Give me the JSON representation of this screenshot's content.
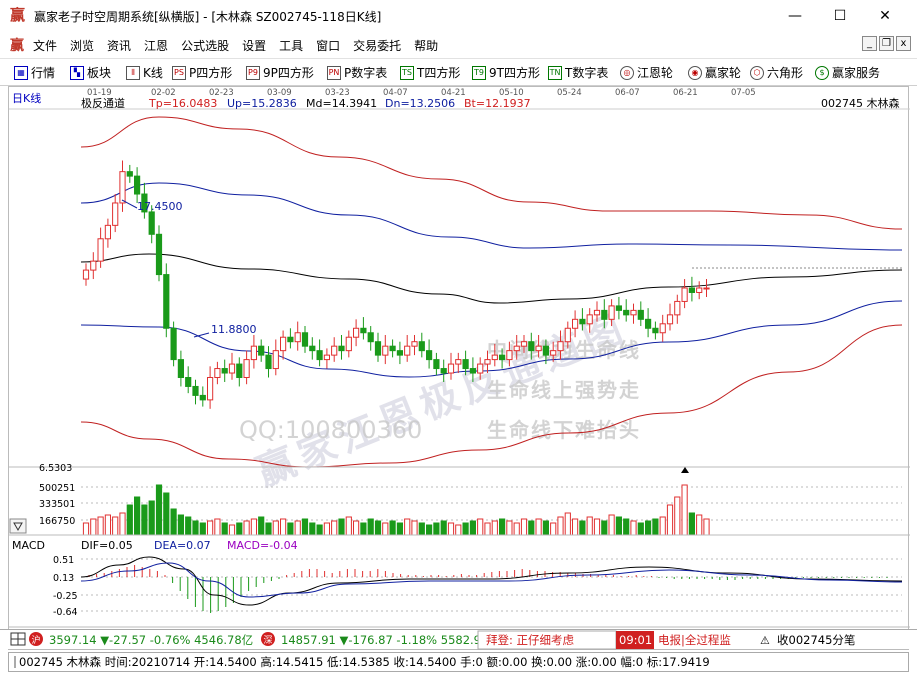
{
  "window": {
    "title": "赢家老子时空周期系统[纵横版] - [木林森  SZ002745-118日K线]",
    "logo": "赢",
    "min_glyph": "—",
    "max_glyph": "☐",
    "close_glyph": "✕"
  },
  "menu": {
    "logo": "赢",
    "items": [
      "文件",
      "浏览",
      "资讯",
      "江恩",
      "公式选股",
      "设置",
      "工具",
      "窗口",
      "交易委托",
      "帮助"
    ],
    "mdi_buttons": [
      "_",
      "❐",
      "x"
    ]
  },
  "toolbar": {
    "items": [
      {
        "label": "行情",
        "icon": "grid-icon",
        "glyph": "▦"
      },
      {
        "label": "板块",
        "icon": "blocks-icon",
        "glyph": "▚"
      },
      {
        "label": "K线",
        "icon": "candlestick-icon",
        "glyph": "⫴"
      },
      {
        "label": "P四方形",
        "icon": "p-square-icon",
        "glyph": "PS"
      },
      {
        "label": "9P四方形",
        "icon": "9p-square-icon",
        "glyph": "P9"
      },
      {
        "label": "P数字表",
        "icon": "p-number-table-icon",
        "glyph": "PN"
      },
      {
        "label": "T四方形",
        "icon": "t-square-icon",
        "glyph": "TS"
      },
      {
        "label": "9T四方形",
        "icon": "9t-square-icon",
        "glyph": "T9"
      },
      {
        "label": "T数字表",
        "icon": "t-number-table-icon",
        "glyph": "TN"
      },
      {
        "label": "江恩轮",
        "icon": "gann-wheel-icon",
        "glyph": "◎"
      },
      {
        "label": "赢家轮",
        "icon": "winner-wheel-icon",
        "glyph": "◉"
      },
      {
        "label": "六角形",
        "icon": "hexagon-icon",
        "glyph": "⬡"
      },
      {
        "label": "赢家服务",
        "icon": "dollar-icon",
        "glyph": "$"
      }
    ]
  },
  "chart": {
    "period_label": "日K线",
    "indicator_name": "极反通道",
    "tp": "Tp=16.0483",
    "up": "Up=15.2836",
    "md": "Md=14.3941",
    "dn": "Dn=13.2506",
    "bt": "Bt=12.1937",
    "stock": "002745  木林森",
    "date_labels": [
      "01-19",
      "02-02",
      "02-23",
      "03-09",
      "03-23",
      "04-07",
      "04-21",
      "05-10",
      "05-24",
      "06-07",
      "06-21",
      "07-05"
    ],
    "high_label": "17.4500",
    "low_label": "11.8800",
    "watermark_main": "赢家江恩极反通道图",
    "watermark_lines": [
      "中间线为生命线",
      "生命线上强势走",
      "生命线下难抬头"
    ],
    "watermark_qq": "QQ:100800360",
    "volume_ticks": [
      "6.5303",
      "500251",
      "333501",
      "166750"
    ],
    "macd_label": "MACD",
    "dif": "DIF=0.05",
    "dea": "DEA=0.07",
    "macd_value": "MACD=-0.04",
    "macd_ticks": [
      "0.51",
      "0.13",
      "-0.25",
      "-0.64"
    ],
    "colors": {
      "up": "#e03030",
      "down": "#1a9a1a",
      "outer": "#c02020",
      "mid": "#1020a0",
      "life": "#000000"
    }
  },
  "chart_data": {
    "type": "candlestick",
    "title": "极反通道",
    "x_labels": [
      "01-19",
      "02-02",
      "02-23",
      "03-09",
      "03-23",
      "04-07",
      "04-21",
      "05-10",
      "05-24",
      "06-07",
      "06-21",
      "07-05"
    ],
    "ylim": [
      10.5,
      18.5
    ],
    "channel": {
      "Tp": 16.0483,
      "Up": 15.2836,
      "Md": 14.3941,
      "Dn": 13.2506,
      "Bt": 12.1937
    },
    "annotations": [
      {
        "label": "17.4500",
        "type": "high"
      },
      {
        "label": "11.8800",
        "type": "low"
      }
    ],
    "closes": [
      14.9,
      15.1,
      15.6,
      15.9,
      16.4,
      17.1,
      17.0,
      16.6,
      16.2,
      15.7,
      14.8,
      13.6,
      12.9,
      12.5,
      12.3,
      12.1,
      12.0,
      12.5,
      12.7,
      12.6,
      12.8,
      12.5,
      12.9,
      13.2,
      13.0,
      12.7,
      13.1,
      13.4,
      13.3,
      13.5,
      13.2,
      13.1,
      12.9,
      13.0,
      13.2,
      13.1,
      13.4,
      13.6,
      13.5,
      13.3,
      13.0,
      13.2,
      13.1,
      13.0,
      13.2,
      13.3,
      13.1,
      12.9,
      12.7,
      12.6,
      12.8,
      12.9,
      12.7,
      12.6,
      12.8,
      12.9,
      13.0,
      12.9,
      13.1,
      13.2,
      13.3,
      13.1,
      13.2,
      13.0,
      13.1,
      13.3,
      13.6,
      13.8,
      13.7,
      13.9,
      14.0,
      13.8,
      14.1,
      14.0,
      13.9,
      14.0,
      13.8,
      13.6,
      13.5,
      13.7,
      13.9,
      14.2,
      14.5,
      14.4,
      14.5,
      14.5
    ],
    "volume": {
      "ticks": [
        "6.5303",
        "500251",
        "333501",
        "166750"
      ]
    },
    "macd": {
      "DIF": 0.05,
      "DEA": 0.07,
      "MACD": -0.04,
      "ticks": [
        "0.51",
        "0.13",
        "-0.25",
        "-0.64"
      ]
    }
  },
  "status": {
    "sh_badge": "沪",
    "sh_text": "3597.14 ▼-27.57 -0.76% 4546.78亿",
    "sz_badge": "深",
    "sz_text": "14857.91 ▼-176.87 -1.18% 5582.9",
    "ticker": "拜登: 正仔细考虑",
    "time": "09:01",
    "news": "电报|全过程监",
    "alert": "收002745分笔",
    "detail": "002745 木林森 时间:20210714 开:14.5400 高:14.5415 低:14.5385 收:14.5400 手:0 额:0.00 换:0.00 涨:0.00 幅:0 标:17.9419"
  }
}
